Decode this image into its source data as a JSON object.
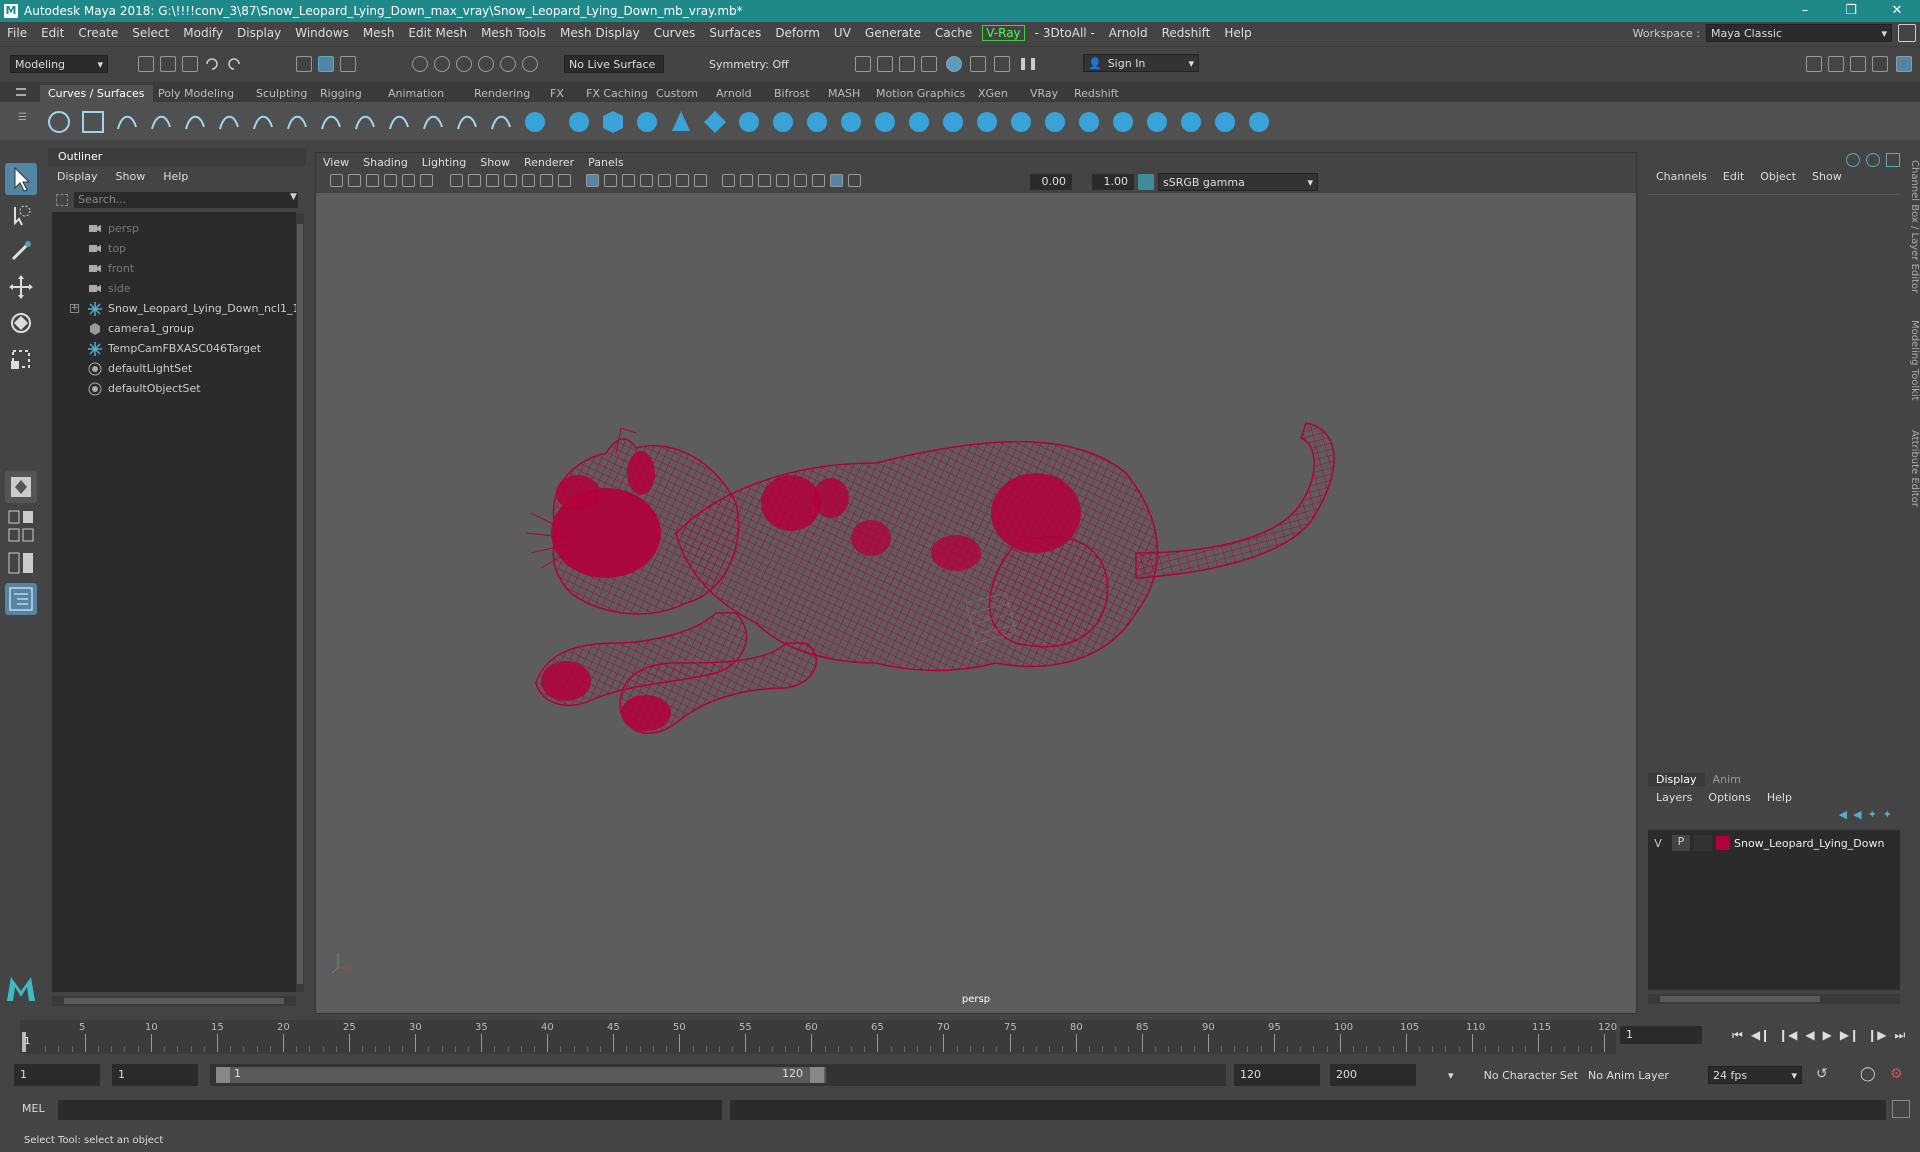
{
  "title_bar": {
    "text": "Autodesk Maya 2018: G:\\!!!!conv_3\\87\\Snow_Leopard_Lying_Down_max_vray\\Snow_Leopard_Lying_Down_mb_vray.mb*",
    "logo": "M"
  },
  "menus": [
    "File",
    "Edit",
    "Create",
    "Select",
    "Modify",
    "Display",
    "Windows",
    "Mesh",
    "Edit Mesh",
    "Mesh Tools",
    "Mesh Display",
    "Curves",
    "Surfaces",
    "Deform",
    "UV",
    "Generate",
    "Cache"
  ],
  "menus2": [
    "- 3DtoAll -",
    "Arnold",
    "Redshift",
    "Help"
  ],
  "vray_menu": "V-Ray",
  "workspace": {
    "label": "Workspace :",
    "value": "Maya Classic"
  },
  "status_line": {
    "mode": "Modeling",
    "live_surface": "No Live Surface",
    "symmetry": "Symmetry: Off",
    "sign_in": "Sign In"
  },
  "shelf_tabs": [
    "Curves / Surfaces",
    "Poly Modeling",
    "Sculpting",
    "Rigging",
    "Animation",
    "Rendering",
    "FX",
    "FX Caching",
    "Custom",
    "Arnold",
    "Bifrost",
    "MASH",
    "Motion Graphics",
    "XGen",
    "VRay",
    "Redshift"
  ],
  "outliner": {
    "title": "Outliner",
    "menu": [
      "Display",
      "Show",
      "Help"
    ],
    "search_placeholder": "Search...",
    "items": [
      {
        "label": "persp",
        "icon": "camera-icon",
        "dim": true
      },
      {
        "label": "top",
        "icon": "camera-icon",
        "dim": true
      },
      {
        "label": "front",
        "icon": "camera-icon",
        "dim": true
      },
      {
        "label": "side",
        "icon": "camera-icon",
        "dim": true
      },
      {
        "label": "Snow_Leopard_Lying_Down_ncl1_1",
        "icon": "joint-icon",
        "dim": false,
        "expandable": true
      },
      {
        "label": "camera1_group",
        "icon": "group-icon",
        "dim": false
      },
      {
        "label": "TempCamFBXASC046Target",
        "icon": "joint-icon",
        "dim": false
      },
      {
        "label": "defaultLightSet",
        "icon": "set-icon",
        "dim": false
      },
      {
        "label": "defaultObjectSet",
        "icon": "set-icon",
        "dim": false
      }
    ]
  },
  "viewport": {
    "menu": [
      "View",
      "Shading",
      "Lighting",
      "Show",
      "Renderer",
      "Panels"
    ],
    "exposure": "0.00",
    "gamma": "1.00",
    "color_space": "sSRGB gamma",
    "camera_label": "persp",
    "wire_color": "#b3003a"
  },
  "channel_box": {
    "menu": [
      "Channels",
      "Edit",
      "Object",
      "Show"
    ]
  },
  "layer_editor": {
    "tabs": [
      "Display",
      "Anim"
    ],
    "menu": [
      "Layers",
      "Options",
      "Help"
    ],
    "layer": {
      "v": "V",
      "p": "P",
      "name": "Snow_Leopard_Lying_Down",
      "color": "#b3003a"
    }
  },
  "side_tabs": [
    "Channel Box / Layer Editor",
    "Modeling Toolkit",
    "Attribute Editor"
  ],
  "timeline": {
    "ticks": [
      "5",
      "10",
      "15",
      "20",
      "25",
      "30",
      "35",
      "40",
      "45",
      "50",
      "55",
      "60",
      "65",
      "70",
      "75",
      "80",
      "85",
      "90",
      "95",
      "100",
      "105",
      "110",
      "115",
      "120"
    ],
    "start_label": "1",
    "current_frame": "1"
  },
  "range": {
    "start": "1",
    "playback_start": "1",
    "slider_start": "1",
    "slider_end": "120",
    "playback_end": "120",
    "end": "200",
    "character_set": "No Character Set",
    "anim_layer": "No Anim Layer",
    "fps": "24 fps"
  },
  "command": {
    "label": "MEL"
  },
  "help_line": "Select Tool: select an object"
}
